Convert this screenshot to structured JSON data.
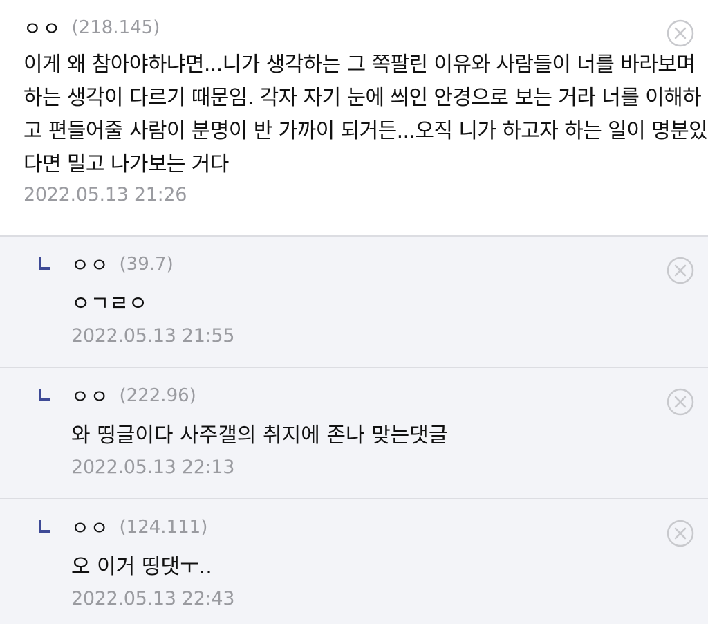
{
  "comments": [
    {
      "nickname": "ㅇㅇ",
      "ip": "(218.145)",
      "text": "이게 왜 참아야하냐면...니가 생각하는 그 쪽팔린 이유와 사람들이 너를 바라보며 하는 생각이 다르기 때문임. 각자 자기 눈에 씌인 안경으로 보는 거라 너를 이해하고 편들어줄 사람이 분명이 반 가까이 되거든...오직 니가 하고자 하는 일이 명분있다면 밀고 나가보는 거다",
      "date": "2022.05.13 21:26"
    }
  ],
  "replies": [
    {
      "nickname": "ㅇㅇ",
      "ip": "(39.7)",
      "text": "ㅇㄱㄹㅇ",
      "date": "2022.05.13 21:55"
    },
    {
      "nickname": "ㅇㅇ",
      "ip": "(222.96)",
      "text": "와 띵글이다 사주갤의 취지에 존나 맞는댓글",
      "date": "2022.05.13 22:13"
    },
    {
      "nickname": "ㅇㅇ",
      "ip": "(124.111)",
      "text": "오 이거 띵댓ㅜ..",
      "date": "2022.05.13 22:43"
    }
  ],
  "icons": {
    "delete": "close-circle-icon",
    "reply_marker": "reply-arrow-icon"
  },
  "colors": {
    "reply_background": "#f3f4f8",
    "divider": "#dcdde2",
    "meta_text": "#9a9ba0",
    "reply_marker": "#3e4a96",
    "delete_icon": "#c8c9cd"
  }
}
